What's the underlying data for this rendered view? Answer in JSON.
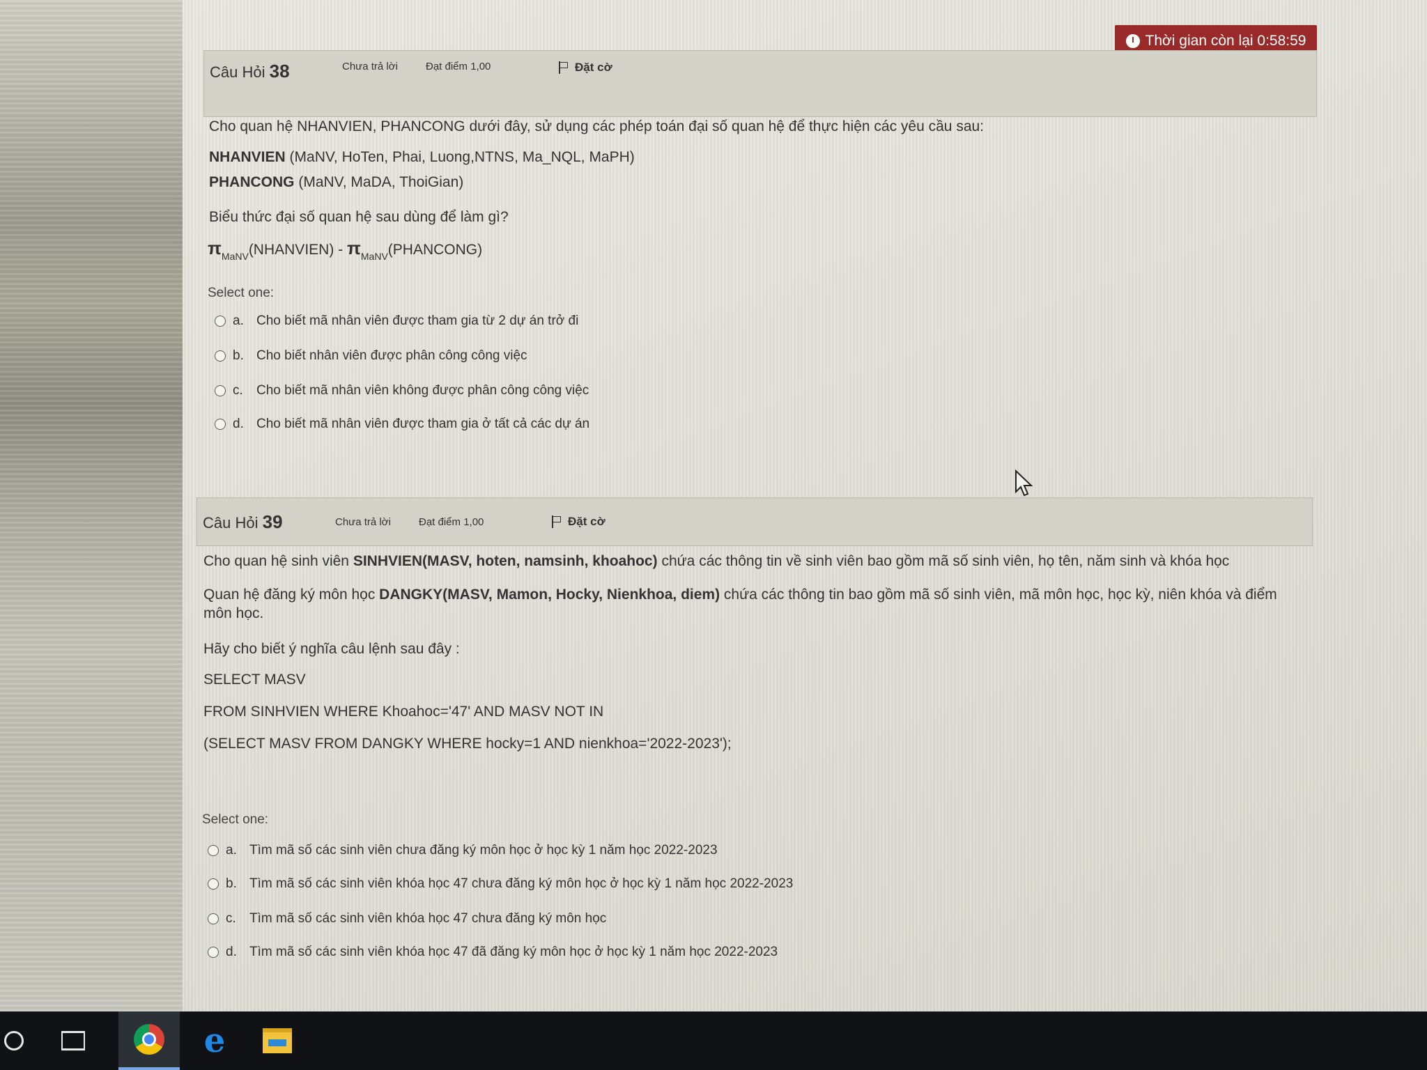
{
  "timer": {
    "label": "Thời gian còn lại 0:58:59"
  },
  "q38": {
    "prefix": "Câu Hỏi",
    "number": "38",
    "state": "Chưa trả lời",
    "mark": "Đạt điểm 1,00",
    "flag": "Đặt cờ",
    "intro": "Cho quan hệ NHANVIEN, PHANCONG dưới đây, sử dụng các phép toán đại số quan hệ để thực hiện các yêu cầu sau:",
    "rel1_name": "NHANVIEN",
    "rel1_attrs": " (MaNV, HoTen, Phai, Luong,NTNS, Ma_NQL, MaPH)",
    "rel2_name": "PHANCONG",
    "rel2_attrs": " (MaNV, MaDA, ThoiGian)",
    "question": "Biểu thức đại số quan hệ sau dùng để làm gì?",
    "expr": {
      "pi1": "π",
      "sub1": "MaNV",
      "arg1": "(NHANVIEN) - ",
      "pi2": "π",
      "sub2": "MaNV",
      "arg2": "(PHANCONG)"
    },
    "select_label": "Select one:",
    "options": [
      {
        "letter": "a.",
        "text": "Cho biết mã nhân viên được tham gia từ 2 dự án trở đi"
      },
      {
        "letter": "b.",
        "text": "Cho biết nhân viên được phân công công việc"
      },
      {
        "letter": "c.",
        "text": "Cho biết mã nhân viên không được phân công công việc"
      },
      {
        "letter": "d.",
        "text": "Cho biết mã nhân viên được tham gia ở tất cả các dự án"
      }
    ]
  },
  "q39": {
    "prefix": "Câu Hỏi",
    "number": "39",
    "state": "Chưa trả lời",
    "mark": "Đạt điểm 1,00",
    "flag": "Đặt cờ",
    "line1_a": "Cho quan hệ sinh viên ",
    "line1_b": "SINHVIEN(MASV, hoten, namsinh, khoahoc)",
    "line1_c": " chứa các thông tin về sinh viên bao gồm mã số sinh viên, họ tên, năm sinh và khóa học",
    "line2_a": "Quan hệ đăng ký môn học ",
    "line2_b": "DANGKY(MASV, Mamon, Hocky, Nienkhoa, diem)",
    "line2_c": " chứa các thông tin bao gồm mã số sinh viên, mã môn học, học kỳ, niên khóa và điểm môn học.",
    "question": "Hãy cho biết ý nghĩa câu lệnh sau đây :",
    "sql1": "SELECT MASV",
    "sql2": "FROM SINHVIEN WHERE Khoahoc='47' AND MASV NOT IN",
    "sql3": "(SELECT MASV FROM DANGKY WHERE hocky=1 AND nienkhoa='2022-2023');",
    "select_label": "Select one:",
    "options": [
      {
        "letter": "a.",
        "text": "Tìm mã số các sinh viên chưa đăng ký môn học ở học kỳ 1 năm học 2022-2023"
      },
      {
        "letter": "b.",
        "text": "Tìm mã số các sinh viên khóa học 47 chưa đăng ký môn học ở học kỳ 1 năm học 2022-2023"
      },
      {
        "letter": "c.",
        "text": "Tìm mã số các sinh viên khóa học 47 chưa đăng ký môn học"
      },
      {
        "letter": "d.",
        "text": "Tìm mã số các sinh viên khóa học 47 đã đăng ký môn học ở học kỳ 1 năm học 2022-2023"
      }
    ]
  },
  "taskbar": {
    "icons": [
      "cortana-icon",
      "task-view-icon",
      "chrome-icon",
      "edge-icon",
      "file-explorer-icon"
    ]
  }
}
